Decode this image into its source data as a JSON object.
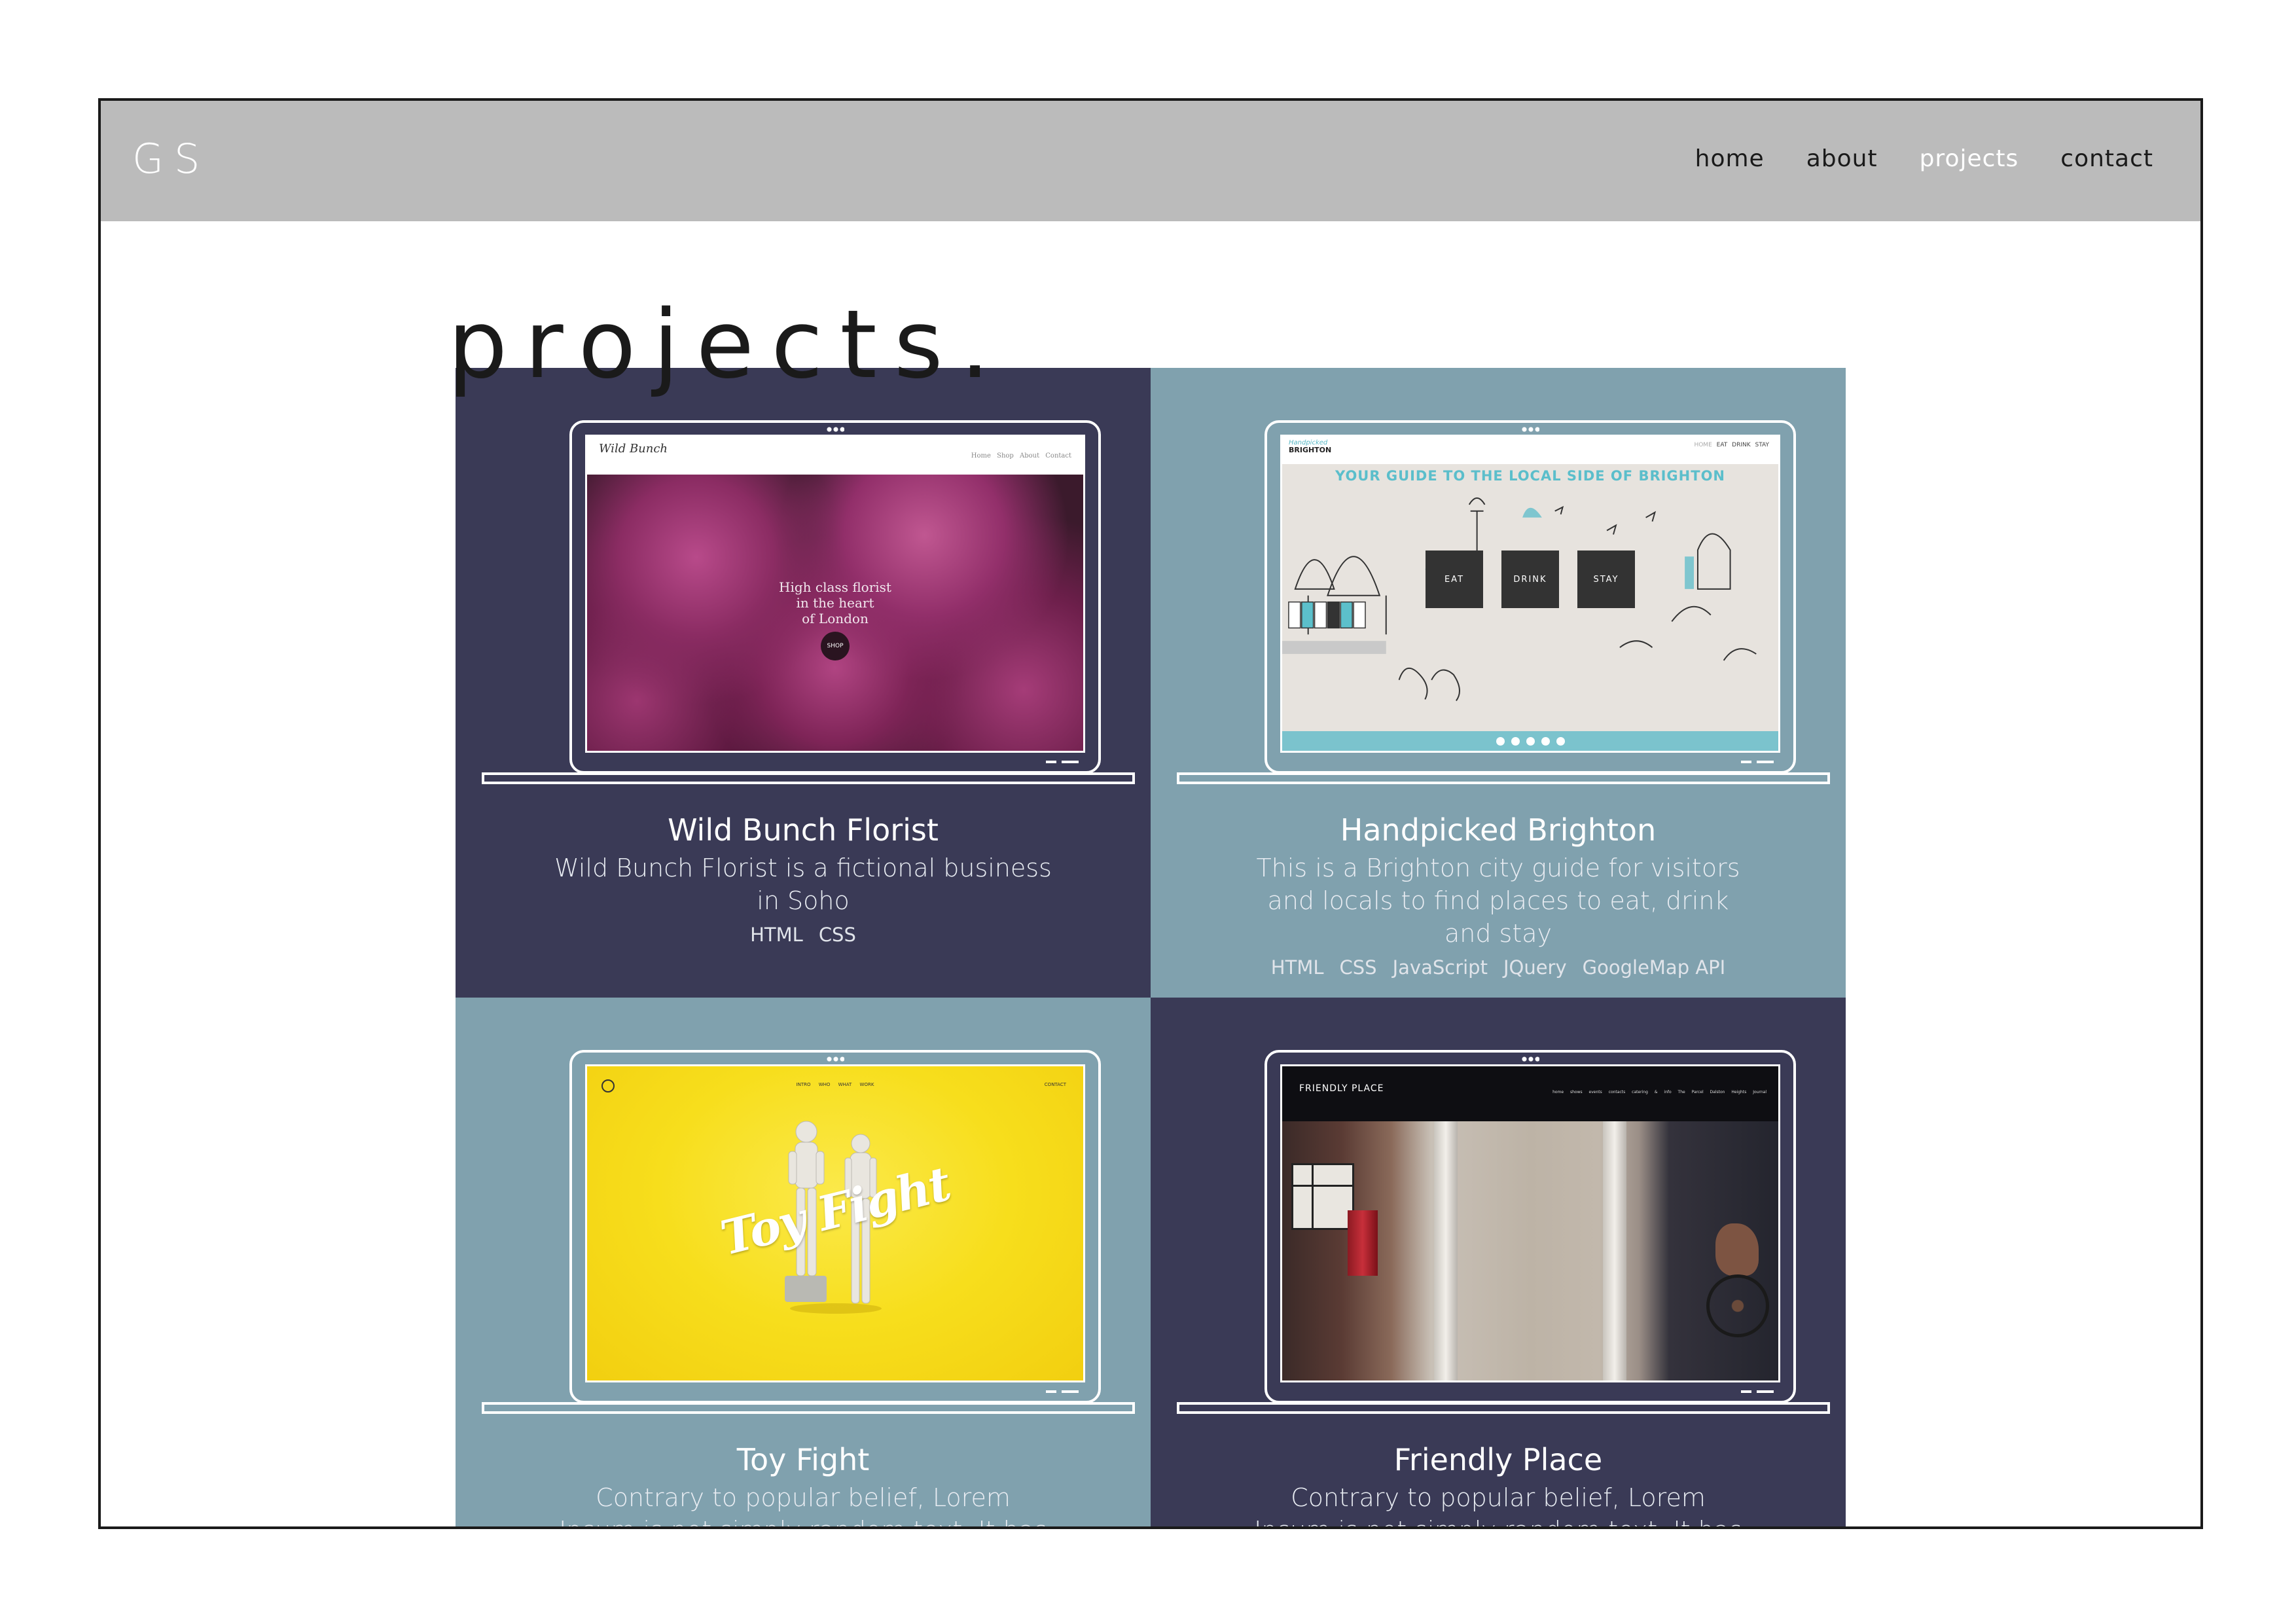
{
  "header": {
    "logo": "GS",
    "nav": [
      {
        "label": "home",
        "active": false
      },
      {
        "label": "about",
        "active": false
      },
      {
        "label": "projects",
        "active": true
      },
      {
        "label": "contact",
        "active": false
      }
    ]
  },
  "page": {
    "title": "projects."
  },
  "colors": {
    "header_bg": "#bbbbbb",
    "dark_card": "#3a3a56",
    "light_card": "#80a1ae"
  },
  "projects": [
    {
      "title": "Wild Bunch Florist",
      "description": "Wild Bunch Florist is a fictional business in Soho",
      "tags": [
        "HTML",
        "CSS"
      ],
      "theme": "dark",
      "screen": {
        "logo": "Wild Bunch",
        "nav": "Home Shop About Contact",
        "tagline": [
          "High class florist",
          "in the heart",
          "of London"
        ],
        "button": "SHOP"
      }
    },
    {
      "title": "Handpicked Brighton",
      "description": "This is a Brighton city guide for visitors and locals to find places to eat, drink and stay",
      "tags": [
        "HTML",
        "CSS",
        "JavaScript",
        "JQuery",
        "GoogleMap API"
      ],
      "theme": "light",
      "screen": {
        "logo_small": "Handpicked",
        "logo": "BRIGHTON",
        "nav": [
          "HOME",
          "EAT",
          "DRINK",
          "STAY"
        ],
        "headline": "YOUR GUIDE TO THE LOCAL SIDE OF BRIGHTON",
        "boxes": [
          "EAT",
          "DRINK",
          "STAY"
        ]
      }
    },
    {
      "title": "Toy Fight",
      "description": "Contrary to popular belief, Lorem Ipsum is not simply random text. It has roots in a piece of",
      "tags": [],
      "theme": "light",
      "screen": {
        "nav": "INTRO WHO WHAT WORK",
        "contact": "CONTACT",
        "word": "Toy Fight"
      }
    },
    {
      "title": "Friendly Place",
      "description": "Contrary to popular belief, Lorem Ipsum is not simply random text. It has roots in a piece of",
      "tags": [],
      "theme": "dark",
      "screen": {
        "logo": "FRIENDLY PLACE",
        "nav": "home shows events contacts catering & info The Parcel Dalston Heights Journal"
      }
    }
  ]
}
